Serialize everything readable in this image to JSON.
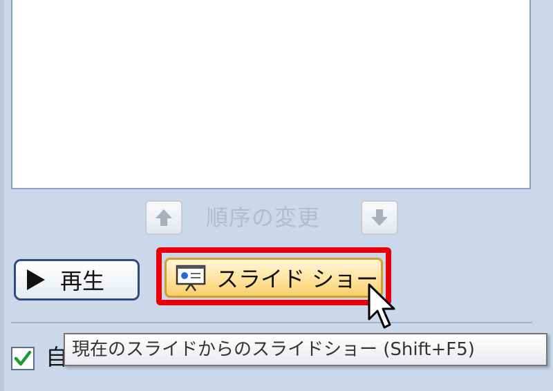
{
  "reorder": {
    "label": "順序の変更",
    "up_icon": "up-arrow-icon",
    "down_icon": "down-arrow-icon"
  },
  "buttons": {
    "play_label": "再生",
    "play_icon": "play-icon",
    "slideshow_label": "スライド ショー",
    "slideshow_icon": "presentation-icon"
  },
  "option": {
    "checked": true,
    "label_partial": "自"
  },
  "tooltip": {
    "text": "現在のスライドからのスライドショー (Shift+F5)"
  },
  "colors": {
    "panel_bg": "#cad8ea",
    "highlight": "#e8000b",
    "slideshow_btn": "#ffe39e"
  }
}
